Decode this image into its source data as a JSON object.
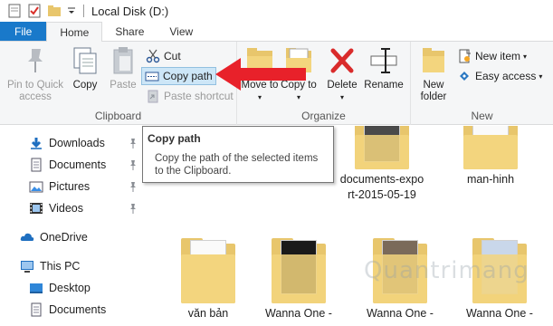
{
  "window": {
    "title": "Local Disk (D:)"
  },
  "tabs": [
    {
      "label": "File"
    },
    {
      "label": "Home"
    },
    {
      "label": "Share"
    },
    {
      "label": "View"
    }
  ],
  "clipboard": {
    "group_label": "Clipboard",
    "pin_label": "Pin to Quick access",
    "copy_label": "Copy",
    "paste_label": "Paste",
    "cut_label": "Cut",
    "copy_path_label": "Copy path",
    "paste_shortcut_label": "Paste shortcut"
  },
  "organize": {
    "group_label": "Organize",
    "move_to_label": "Move to",
    "copy_to_label": "Copy to",
    "delete_label": "Delete",
    "rename_label": "Rename"
  },
  "new": {
    "group_label": "New",
    "new_folder_label": "New folder",
    "new_item_label": "New item",
    "easy_access_label": "Easy access"
  },
  "tooltip": {
    "title": "Copy path",
    "body": "Copy the path of the selected items to the Clipboard."
  },
  "nav": {
    "items": [
      {
        "label": "Downloads",
        "icon": "download-icon",
        "pinned": true
      },
      {
        "label": "Documents",
        "icon": "documents-icon",
        "pinned": true
      },
      {
        "label": "Pictures",
        "icon": "pictures-icon",
        "pinned": true
      },
      {
        "label": "Videos",
        "icon": "videos-icon",
        "pinned": true
      },
      {
        "label": "OneDrive",
        "icon": "onedrive-icon",
        "pinned": false
      },
      {
        "label": "This PC",
        "icon": "this-pc-icon",
        "pinned": false
      },
      {
        "label": "Desktop",
        "icon": "desktop-icon",
        "pinned": false
      },
      {
        "label": "Documents",
        "icon": "documents-icon",
        "pinned": false
      }
    ]
  },
  "files": [
    {
      "name": "documents-export-2015-05-19",
      "line1": "documents-expo",
      "line2": "rt-2015-05-19"
    },
    {
      "name": "man-hinh",
      "line1": "man-hinh",
      "line2": ""
    },
    {
      "name": "văn bản",
      "line1": "văn bản",
      "line2": ""
    },
    {
      "name": "Wanna One -",
      "line1": "Wanna One -",
      "line2": ""
    },
    {
      "name": "Wanna One -",
      "line1": "Wanna One -",
      "line2": ""
    },
    {
      "name": "Wanna One -",
      "line1": "Wanna One -",
      "line2": ""
    }
  ],
  "colors": {
    "file_tab": "#1979ca",
    "accent_red": "#e8212a",
    "folder": "#e8c66c",
    "highlight": "#cde6f7"
  },
  "watermark": "Quantrimang"
}
